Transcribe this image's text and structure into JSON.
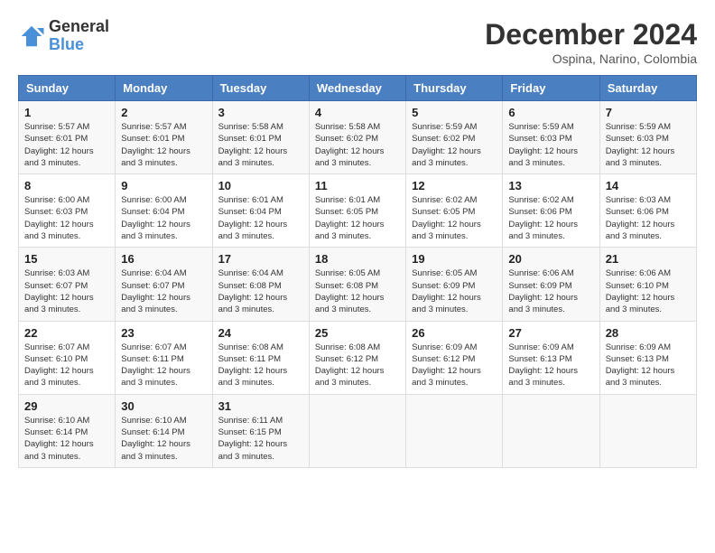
{
  "logo": {
    "line1": "General",
    "line2": "Blue"
  },
  "title": "December 2024",
  "subtitle": "Ospina, Narino, Colombia",
  "days_header": [
    "Sunday",
    "Monday",
    "Tuesday",
    "Wednesday",
    "Thursday",
    "Friday",
    "Saturday"
  ],
  "weeks": [
    [
      {
        "day": "1",
        "sunrise": "5:57 AM",
        "sunset": "6:01 PM",
        "daylight": "12 hours and 3 minutes."
      },
      {
        "day": "2",
        "sunrise": "5:57 AM",
        "sunset": "6:01 PM",
        "daylight": "12 hours and 3 minutes."
      },
      {
        "day": "3",
        "sunrise": "5:58 AM",
        "sunset": "6:01 PM",
        "daylight": "12 hours and 3 minutes."
      },
      {
        "day": "4",
        "sunrise": "5:58 AM",
        "sunset": "6:02 PM",
        "daylight": "12 hours and 3 minutes."
      },
      {
        "day": "5",
        "sunrise": "5:59 AM",
        "sunset": "6:02 PM",
        "daylight": "12 hours and 3 minutes."
      },
      {
        "day": "6",
        "sunrise": "5:59 AM",
        "sunset": "6:03 PM",
        "daylight": "12 hours and 3 minutes."
      },
      {
        "day": "7",
        "sunrise": "5:59 AM",
        "sunset": "6:03 PM",
        "daylight": "12 hours and 3 minutes."
      }
    ],
    [
      {
        "day": "8",
        "sunrise": "6:00 AM",
        "sunset": "6:03 PM",
        "daylight": "12 hours and 3 minutes."
      },
      {
        "day": "9",
        "sunrise": "6:00 AM",
        "sunset": "6:04 PM",
        "daylight": "12 hours and 3 minutes."
      },
      {
        "day": "10",
        "sunrise": "6:01 AM",
        "sunset": "6:04 PM",
        "daylight": "12 hours and 3 minutes."
      },
      {
        "day": "11",
        "sunrise": "6:01 AM",
        "sunset": "6:05 PM",
        "daylight": "12 hours and 3 minutes."
      },
      {
        "day": "12",
        "sunrise": "6:02 AM",
        "sunset": "6:05 PM",
        "daylight": "12 hours and 3 minutes."
      },
      {
        "day": "13",
        "sunrise": "6:02 AM",
        "sunset": "6:06 PM",
        "daylight": "12 hours and 3 minutes."
      },
      {
        "day": "14",
        "sunrise": "6:03 AM",
        "sunset": "6:06 PM",
        "daylight": "12 hours and 3 minutes."
      }
    ],
    [
      {
        "day": "15",
        "sunrise": "6:03 AM",
        "sunset": "6:07 PM",
        "daylight": "12 hours and 3 minutes."
      },
      {
        "day": "16",
        "sunrise": "6:04 AM",
        "sunset": "6:07 PM",
        "daylight": "12 hours and 3 minutes."
      },
      {
        "day": "17",
        "sunrise": "6:04 AM",
        "sunset": "6:08 PM",
        "daylight": "12 hours and 3 minutes."
      },
      {
        "day": "18",
        "sunrise": "6:05 AM",
        "sunset": "6:08 PM",
        "daylight": "12 hours and 3 minutes."
      },
      {
        "day": "19",
        "sunrise": "6:05 AM",
        "sunset": "6:09 PM",
        "daylight": "12 hours and 3 minutes."
      },
      {
        "day": "20",
        "sunrise": "6:06 AM",
        "sunset": "6:09 PM",
        "daylight": "12 hours and 3 minutes."
      },
      {
        "day": "21",
        "sunrise": "6:06 AM",
        "sunset": "6:10 PM",
        "daylight": "12 hours and 3 minutes."
      }
    ],
    [
      {
        "day": "22",
        "sunrise": "6:07 AM",
        "sunset": "6:10 PM",
        "daylight": "12 hours and 3 minutes."
      },
      {
        "day": "23",
        "sunrise": "6:07 AM",
        "sunset": "6:11 PM",
        "daylight": "12 hours and 3 minutes."
      },
      {
        "day": "24",
        "sunrise": "6:08 AM",
        "sunset": "6:11 PM",
        "daylight": "12 hours and 3 minutes."
      },
      {
        "day": "25",
        "sunrise": "6:08 AM",
        "sunset": "6:12 PM",
        "daylight": "12 hours and 3 minutes."
      },
      {
        "day": "26",
        "sunrise": "6:09 AM",
        "sunset": "6:12 PM",
        "daylight": "12 hours and 3 minutes."
      },
      {
        "day": "27",
        "sunrise": "6:09 AM",
        "sunset": "6:13 PM",
        "daylight": "12 hours and 3 minutes."
      },
      {
        "day": "28",
        "sunrise": "6:09 AM",
        "sunset": "6:13 PM",
        "daylight": "12 hours and 3 minutes."
      }
    ],
    [
      {
        "day": "29",
        "sunrise": "6:10 AM",
        "sunset": "6:14 PM",
        "daylight": "12 hours and 3 minutes."
      },
      {
        "day": "30",
        "sunrise": "6:10 AM",
        "sunset": "6:14 PM",
        "daylight": "12 hours and 3 minutes."
      },
      {
        "day": "31",
        "sunrise": "6:11 AM",
        "sunset": "6:15 PM",
        "daylight": "12 hours and 3 minutes."
      },
      null,
      null,
      null,
      null
    ]
  ]
}
